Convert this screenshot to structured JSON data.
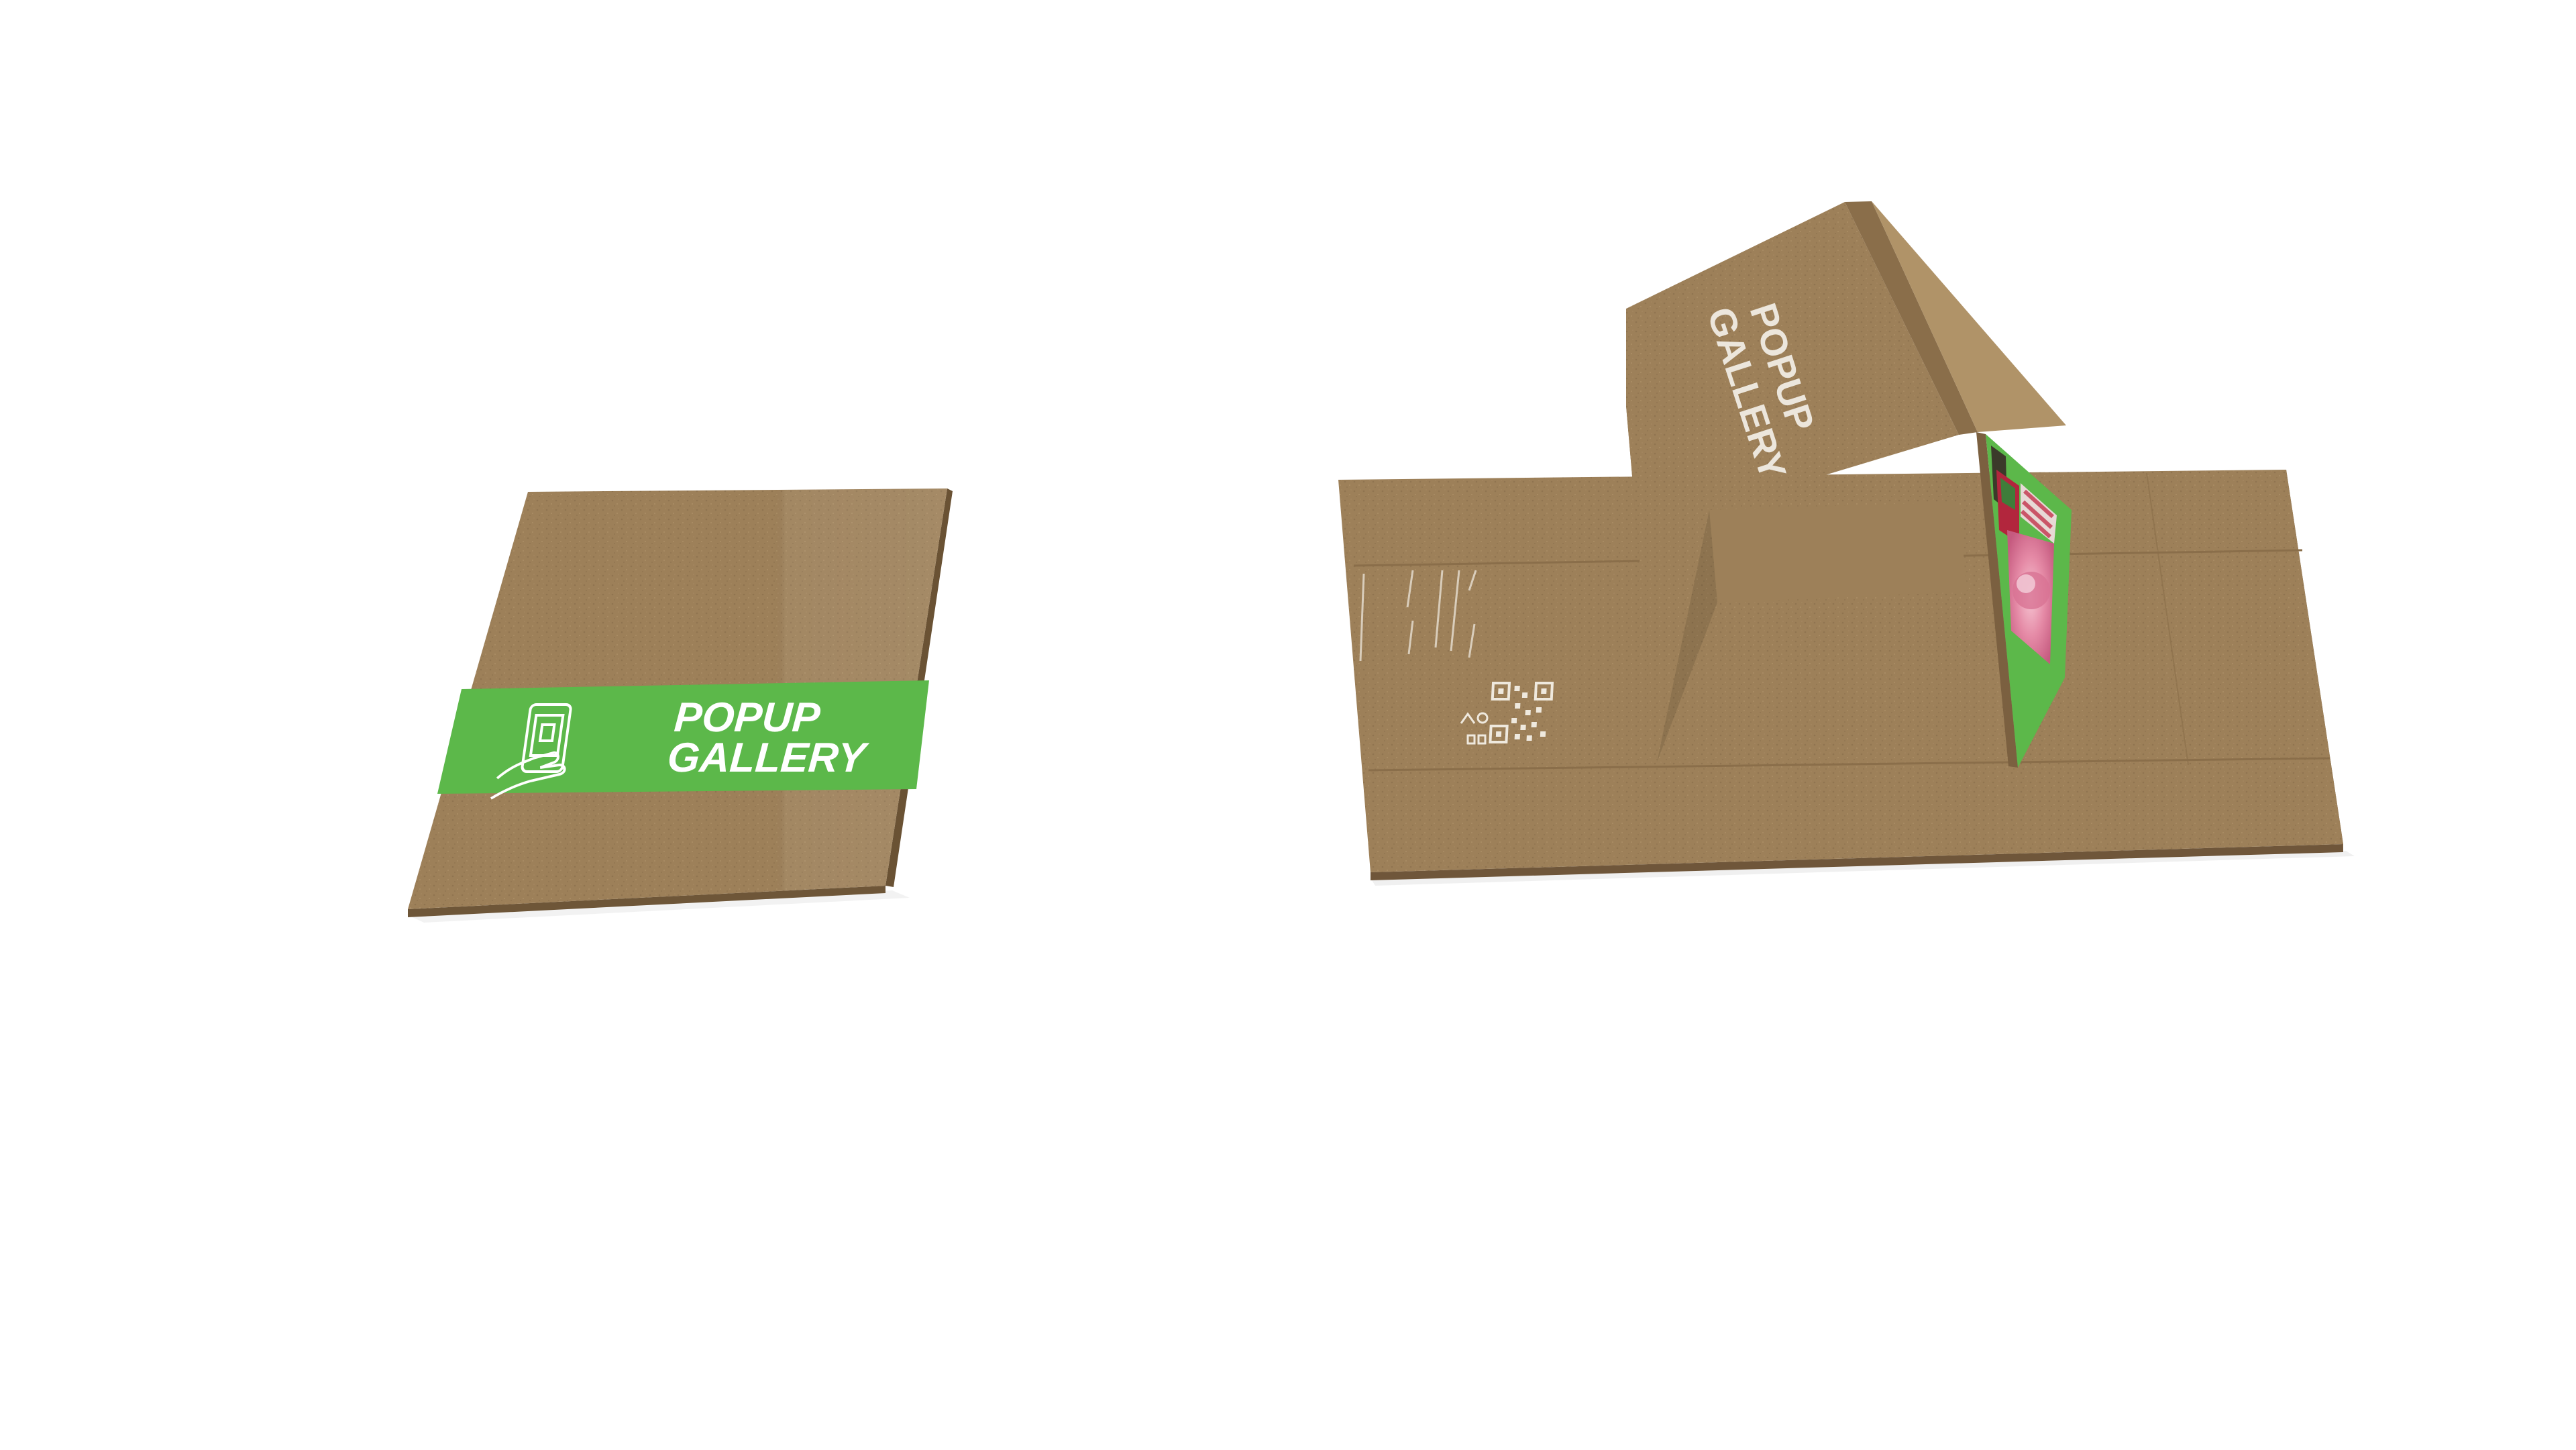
{
  "scene": {
    "background": "#ffffff",
    "kraft_color": "#9c7f58",
    "accent_green": "#5cb84a"
  },
  "closed_book": {
    "band_title_line1": "POPUP",
    "band_title_line2": "GALLERY",
    "band_icon": "phone-in-hand-icon"
  },
  "popup_book": {
    "roof_title_line1": "POPUP",
    "roof_title_line2": "GALLERY",
    "qr_icon": "qr-code-icon",
    "artwork_panel": "green-artwork-panel"
  }
}
